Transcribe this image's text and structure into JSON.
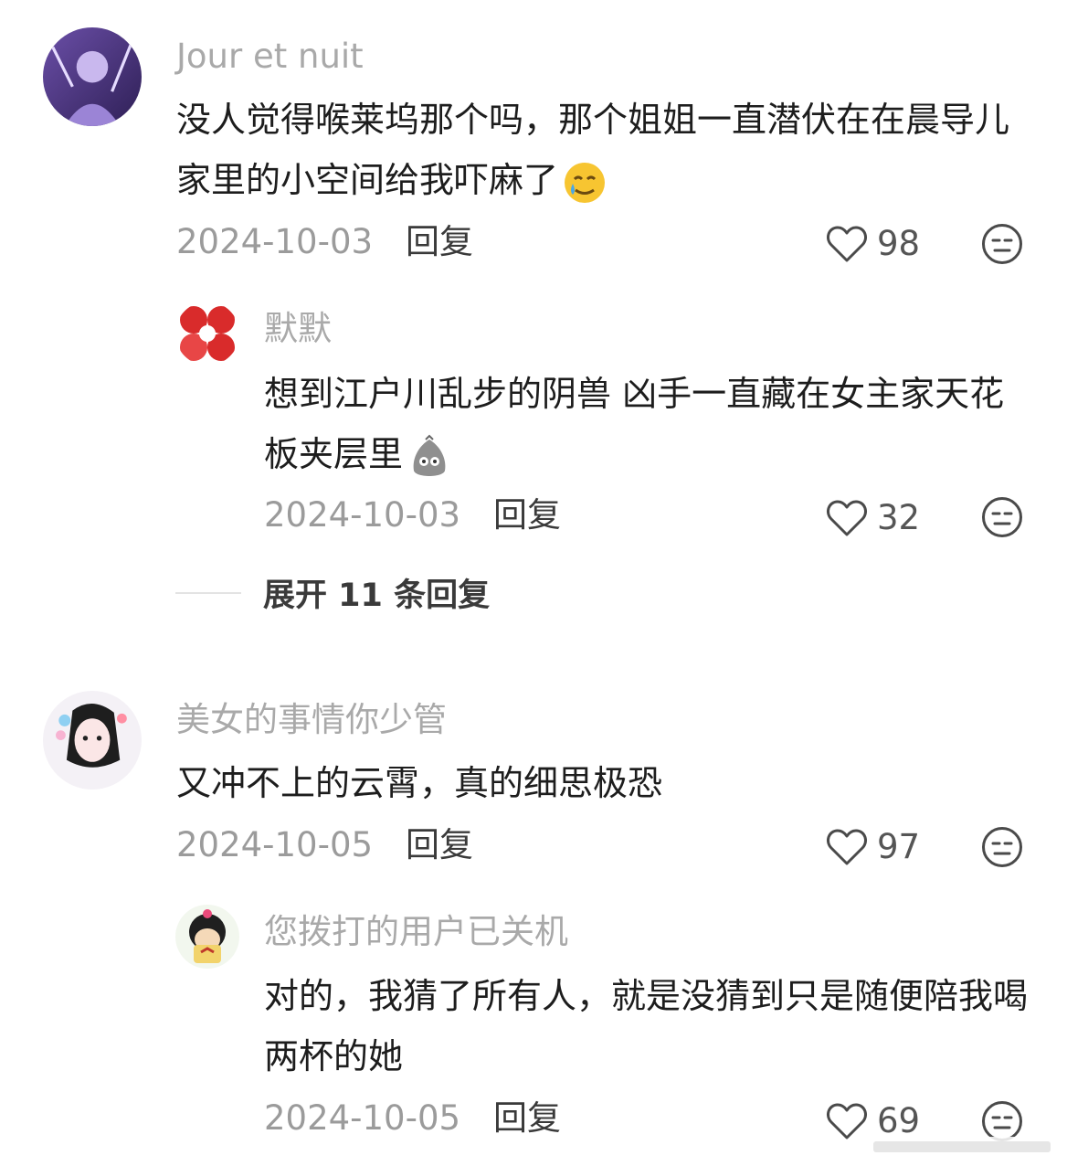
{
  "comments": [
    {
      "username": "Jour et nuit",
      "text": "没人觉得喉莱坞那个吗，那个姐姐一直潜伏在在晨导儿家里的小空间给我吓麻了",
      "emoji": "crying-smile-emoji",
      "date": "2024-10-03",
      "reply_label": "回复",
      "likes": "98",
      "replies": [
        {
          "username": "默默",
          "text": "想到江户川乱步的阴兽 凶手一直藏在女主家天花板夹层里",
          "emoji": "grey-blob-emoji",
          "date": "2024-10-03",
          "reply_label": "回复",
          "likes": "32"
        }
      ],
      "expand_label": "展开 11 条回复"
    },
    {
      "username": "美女的事情你少管",
      "text": "又冲不上的云霄，真的细思极恐",
      "date": "2024-10-05",
      "reply_label": "回复",
      "likes": "97",
      "replies": [
        {
          "username": "您拨打的用户已关机",
          "text": "对的，我猜了所有人，就是没猜到只是随便陪我喝两杯的她",
          "date": "2024-10-05",
          "reply_label": "回复",
          "likes": "69"
        }
      ]
    }
  ],
  "icons": {
    "like": "heart-outline-icon",
    "dislike": "neutral-face-icon"
  },
  "colors": {
    "username": "#a9a9a9",
    "meta": "#9b9b9b",
    "text": "#1d1d1d"
  }
}
